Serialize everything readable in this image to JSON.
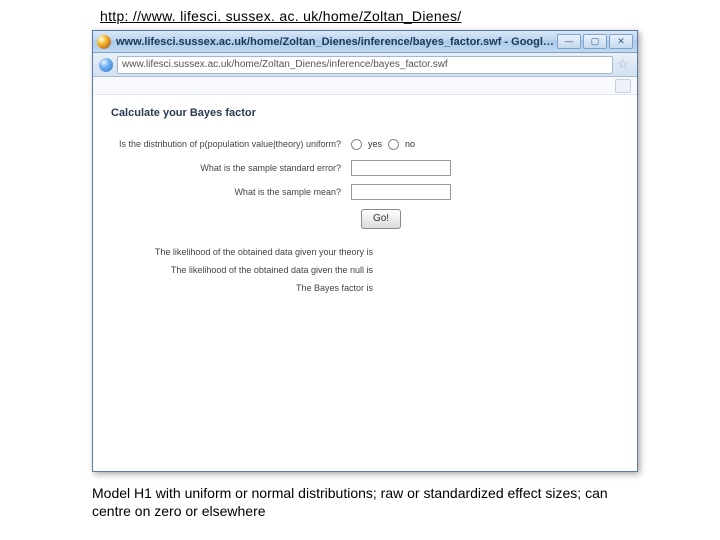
{
  "top_url": "http: //www. lifesci. sussex. ac. uk/home/Zoltan_Dienes/",
  "window": {
    "title": "www.lifesci.sussex.ac.uk/home/Zoltan_Dienes/inference/bayes_factor.swf - Google Chrome",
    "address": "www.lifesci.sussex.ac.uk/home/Zoltan_Dienes/inference/bayes_factor.swf"
  },
  "page": {
    "heading": "Calculate your Bayes factor",
    "q_uniform": "Is the distribution of p(population value|theory) uniform?",
    "opt_yes": "yes",
    "opt_no": "no",
    "q_se": "What is the sample standard error?",
    "q_mean": "What is the sample mean?",
    "go": "Go!",
    "r_theory": "The likelihood of the obtained data given your theory is",
    "r_null": "The likelihood of the obtained data given the null is",
    "r_bf": "The Bayes factor is"
  },
  "caption": "Model H1 with uniform or normal distributions; raw or standardized effect sizes; can centre on zero or elsewhere"
}
